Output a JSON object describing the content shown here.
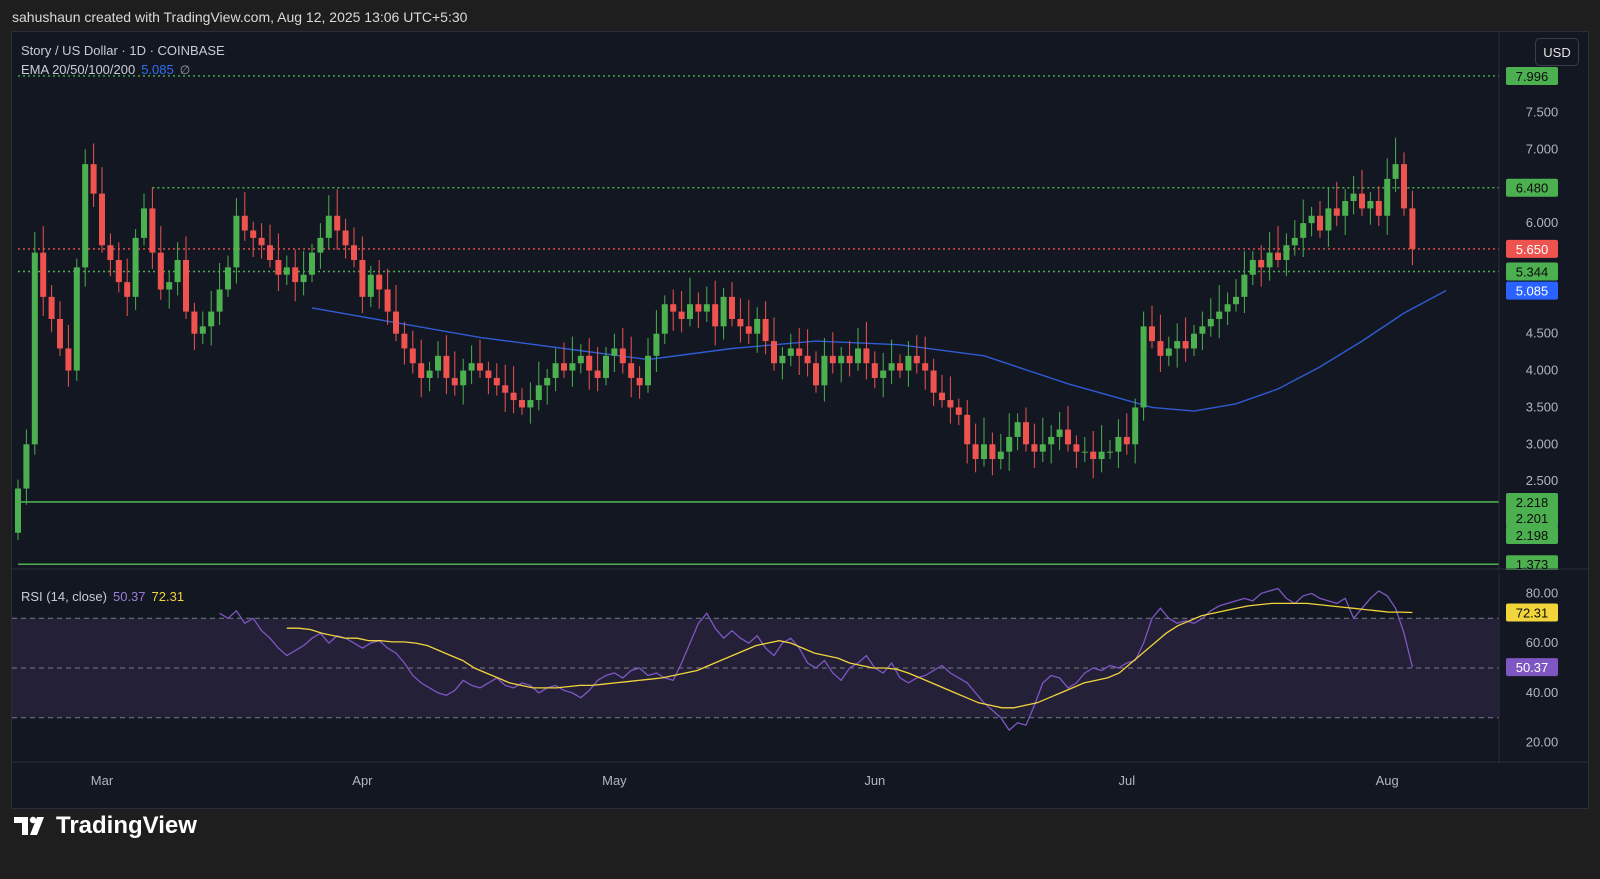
{
  "caption": "sahushaun created with TradingView.com, Aug 12, 2025 13:06 UTC+5:30",
  "currency_button": "USD",
  "brand": "TradingView",
  "legend": {
    "symbol": "Story / US Dollar · 1D · COINBASE",
    "ema_label": "EMA 20/50/100/200",
    "ema_value": "5.085",
    "ema_icon": "∅"
  },
  "rsi_legend": {
    "label": "RSI (14, close)",
    "rsi_value": "50.37",
    "ma_value": "72.31"
  },
  "colors": {
    "background": "#131722",
    "up": "#26a69a",
    "up_bright": "#4caf50",
    "down": "#ef5350",
    "ema": "#2f5bd3",
    "support_line": "#4caf50",
    "current_price_line": "#ef5350",
    "rsi_line": "#7e57c2",
    "rsi_ma": "#f2d43b",
    "rsi_band": "#2a2440"
  },
  "chart_data": [
    {
      "type": "candlestick",
      "symbol": "Story / US Dollar",
      "interval": "1D",
      "exchange": "COINBASE",
      "ylim": [
        1.2,
        8.05
      ],
      "y_ticks": [
        "2.500",
        "3.000",
        "3.500",
        "4.000",
        "4.500",
        "6.000",
        "7.000",
        "7.500"
      ],
      "x_ticks": [
        "Mar",
        "Apr",
        "May",
        "Jun",
        "Jul",
        "Aug"
      ],
      "x_tick_index": [
        10,
        41,
        71,
        102,
        132,
        163
      ],
      "horizontal_levels": [
        {
          "value": 7.996,
          "start_index": 0,
          "style": "dotted",
          "color": "#4caf50"
        },
        {
          "value": 6.48,
          "start_index": 16,
          "style": "dotted",
          "color": "#4caf50"
        },
        {
          "value": 5.65,
          "start_index": 0,
          "style": "dotted",
          "color": "#ef5350"
        },
        {
          "value": 5.344,
          "start_index": 0,
          "style": "dotted",
          "color": "#4caf50"
        },
        {
          "value": 2.218,
          "start_index": 0,
          "style": "solid",
          "color": "#4caf50"
        },
        {
          "value": 1.373,
          "start_index": 0,
          "style": "solid",
          "color": "#4caf50"
        }
      ],
      "price_labels": [
        {
          "text": "7.996",
          "value": 7.996,
          "bg": "#4caf50",
          "fg": "#0b0b0b"
        },
        {
          "text": "6.480",
          "value": 6.48,
          "bg": "#4caf50",
          "fg": "#0b0b0b"
        },
        {
          "text": "5.650",
          "value": 5.65,
          "bg": "#ef5350",
          "fg": "#ffffff"
        },
        {
          "text": "5.344",
          "value": 5.344,
          "bg": "#4caf50",
          "fg": "#0b0b0b"
        },
        {
          "text": "5.085",
          "value": 5.085,
          "bg": "#2962ff",
          "fg": "#ffffff"
        },
        {
          "text": "2.218",
          "value": 2.218,
          "bg": "#4caf50",
          "fg": "#0b0b0b"
        },
        {
          "text": "2.201",
          "value": 2.0,
          "bg": "#4caf50",
          "fg": "#0b0b0b"
        },
        {
          "text": "2.198",
          "value": 1.77,
          "bg": "#4caf50",
          "fg": "#0b0b0b"
        },
        {
          "text": "1.373",
          "value": 1.373,
          "bg": "#4caf50",
          "fg": "#0b0b0b"
        }
      ],
      "close": [
        2.4,
        3.0,
        5.6,
        5.0,
        4.7,
        4.3,
        4.0,
        5.4,
        6.8,
        6.4,
        5.7,
        5.5,
        5.2,
        5.0,
        5.8,
        6.2,
        5.6,
        5.1,
        5.2,
        5.5,
        4.8,
        4.5,
        4.6,
        4.8,
        5.1,
        5.4,
        6.1,
        5.9,
        5.8,
        5.7,
        5.5,
        5.3,
        5.4,
        5.2,
        5.3,
        5.6,
        5.8,
        6.1,
        5.9,
        5.7,
        5.5,
        5.0,
        5.3,
        5.1,
        4.8,
        4.5,
        4.3,
        4.1,
        3.9,
        4.0,
        4.2,
        3.9,
        3.8,
        4.0,
        4.1,
        4.0,
        3.9,
        3.8,
        3.7,
        3.6,
        3.5,
        3.6,
        3.8,
        3.9,
        4.1,
        4.0,
        4.1,
        4.2,
        4.0,
        3.9,
        4.2,
        4.3,
        4.1,
        3.9,
        3.8,
        4.2,
        4.5,
        4.9,
        4.8,
        4.7,
        4.9,
        4.8,
        4.9,
        4.6,
        5.0,
        4.7,
        4.6,
        4.5,
        4.7,
        4.4,
        4.1,
        4.2,
        4.3,
        4.2,
        4.1,
        3.8,
        4.2,
        4.1,
        4.2,
        4.1,
        4.3,
        4.1,
        3.9,
        4.0,
        4.1,
        4.0,
        4.2,
        4.1,
        4.0,
        3.7,
        3.6,
        3.5,
        3.4,
        3.0,
        2.8,
        3.0,
        2.8,
        2.9,
        3.1,
        3.3,
        3.0,
        2.9,
        3.0,
        3.1,
        3.2,
        3.0,
        2.9,
        2.9,
        2.8,
        2.9,
        2.9,
        3.1,
        3.0,
        3.5,
        4.6,
        4.4,
        4.2,
        4.3,
        4.4,
        4.3,
        4.5,
        4.6,
        4.7,
        4.8,
        4.9,
        5.0,
        5.3,
        5.5,
        5.4,
        5.6,
        5.5,
        5.7,
        5.8,
        6.0,
        6.1,
        5.9,
        6.2,
        6.1,
        6.3,
        6.4,
        6.2,
        6.3,
        6.1,
        6.6,
        6.8,
        6.2,
        5.65
      ],
      "ema": [
        {
          "i": 35,
          "v": 4.85
        },
        {
          "i": 45,
          "v": 4.65
        },
        {
          "i": 55,
          "v": 4.45
        },
        {
          "i": 65,
          "v": 4.3
        },
        {
          "i": 75,
          "v": 4.15
        },
        {
          "i": 85,
          "v": 4.3
        },
        {
          "i": 95,
          "v": 4.4
        },
        {
          "i": 105,
          "v": 4.35
        },
        {
          "i": 115,
          "v": 4.2
        },
        {
          "i": 125,
          "v": 3.82
        },
        {
          "i": 135,
          "v": 3.5
        },
        {
          "i": 140,
          "v": 3.45
        },
        {
          "i": 145,
          "v": 3.55
        },
        {
          "i": 150,
          "v": 3.75
        },
        {
          "i": 155,
          "v": 4.05
        },
        {
          "i": 160,
          "v": 4.4
        },
        {
          "i": 165,
          "v": 4.78
        },
        {
          "i": 170,
          "v": 5.085
        }
      ]
    },
    {
      "type": "line",
      "name": "RSI (14, close)",
      "ylim": [
        15,
        85
      ],
      "y_ticks": [
        "20.00",
        "40.00",
        "60.00",
        "80.00"
      ],
      "bands": [
        30,
        50,
        70
      ],
      "rsi": [
        72,
        70,
        73,
        68,
        70,
        65,
        62,
        58,
        55,
        57,
        59,
        62,
        64,
        60,
        63,
        62,
        60,
        58,
        60,
        61,
        58,
        56,
        52,
        47,
        44,
        42,
        40,
        39,
        41,
        45,
        43,
        42,
        44,
        46,
        43,
        42,
        44,
        43,
        40,
        42,
        43,
        41,
        40,
        38,
        41,
        45,
        47,
        48,
        46,
        49,
        50,
        47,
        48,
        46,
        45,
        52,
        60,
        68,
        72,
        66,
        62,
        65,
        62,
        60,
        63,
        58,
        55,
        60,
        62,
        58,
        52,
        50,
        53,
        48,
        45,
        50,
        52,
        55,
        50,
        48,
        52,
        46,
        44,
        46,
        47,
        49,
        51,
        48,
        46,
        44,
        40,
        36,
        33,
        30,
        25,
        28,
        27,
        35,
        44,
        47,
        46,
        42,
        44,
        48,
        50,
        49,
        51,
        50,
        52,
        53,
        60,
        70,
        74,
        70,
        68,
        69,
        68,
        70,
        73,
        75,
        76,
        77,
        78,
        77,
        80,
        81,
        82,
        78,
        76,
        79,
        80,
        78,
        77,
        76,
        78,
        70,
        74,
        78,
        81,
        79,
        74,
        64,
        50.37
      ],
      "ma": [
        66,
        66,
        65.5,
        64,
        63,
        62,
        62,
        61,
        61,
        60.5,
        60.5,
        60,
        59,
        57,
        55,
        53,
        50,
        48,
        46,
        44,
        43,
        42,
        42,
        42,
        42.5,
        43,
        43,
        43.5,
        44,
        44.5,
        45,
        45.5,
        46,
        47,
        48,
        49,
        51,
        53,
        55,
        57,
        59,
        60,
        61,
        60,
        58,
        56,
        55,
        54,
        52,
        51,
        50,
        50,
        49.5,
        48,
        46,
        44,
        42,
        40,
        38,
        36,
        35,
        34,
        34,
        35,
        36,
        38,
        40,
        42,
        44,
        45,
        46,
        48,
        52,
        56,
        60,
        64,
        67,
        69,
        71,
        72,
        73,
        74,
        75,
        75.5,
        76,
        76,
        76,
        76,
        75.5,
        75,
        74.5,
        74,
        73.5,
        73,
        72.5,
        72.5,
        72.31
      ],
      "ma_start_index": 8
    }
  ]
}
